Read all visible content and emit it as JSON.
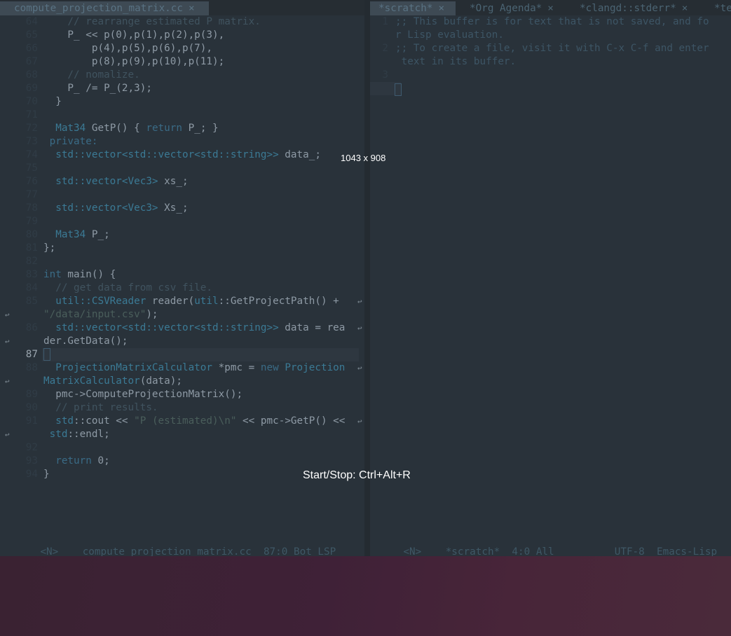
{
  "left_pane": {
    "tab_title": "compute_projection_matrix.cc",
    "tab_close": "×",
    "lines": [
      {
        "num": "64",
        "segments": [
          [
            "c-comment",
            "    // rearrange estimated P matrix."
          ]
        ]
      },
      {
        "num": "65",
        "segments": [
          [
            "c-text",
            "    P_ << p(0),p(1),p(2),p(3),"
          ]
        ]
      },
      {
        "num": "66",
        "segments": [
          [
            "c-text",
            "        p(4),p(5),p(6),p(7),"
          ]
        ]
      },
      {
        "num": "67",
        "segments": [
          [
            "c-text",
            "        p(8),p(9),p(10),p(11);"
          ]
        ]
      },
      {
        "num": "68",
        "segments": [
          [
            "c-comment",
            "    // nomalize."
          ]
        ]
      },
      {
        "num": "69",
        "segments": [
          [
            "c-text",
            "    P_ /= P_(2,3);"
          ]
        ]
      },
      {
        "num": "70",
        "segments": [
          [
            "c-text",
            "  }"
          ]
        ]
      },
      {
        "num": "71",
        "segments": []
      },
      {
        "num": "72",
        "segments": [
          [
            "c-type",
            "  Mat34"
          ],
          [
            "c-text",
            " GetP() { "
          ],
          [
            "c-kw",
            "return"
          ],
          [
            "c-text",
            " P_; }"
          ]
        ]
      },
      {
        "num": "73",
        "segments": [
          [
            "c-kw",
            " private:"
          ]
        ]
      },
      {
        "num": "74",
        "segments": [
          [
            "c-type",
            "  std::vector<std::vector<std::string>>"
          ],
          [
            "c-text",
            " data_;"
          ]
        ]
      },
      {
        "num": "75",
        "segments": []
      },
      {
        "num": "76",
        "segments": [
          [
            "c-type",
            "  std::vector<Vec3>"
          ],
          [
            "c-text",
            " xs_;"
          ]
        ]
      },
      {
        "num": "77",
        "segments": []
      },
      {
        "num": "78",
        "segments": [
          [
            "c-type",
            "  std::vector<Vec3>"
          ],
          [
            "c-text",
            " Xs_;"
          ]
        ]
      },
      {
        "num": "79",
        "segments": []
      },
      {
        "num": "80",
        "segments": [
          [
            "c-type",
            "  Mat34"
          ],
          [
            "c-text",
            " P_;"
          ]
        ]
      },
      {
        "num": "81",
        "segments": [
          [
            "c-text",
            "};"
          ]
        ]
      },
      {
        "num": "82",
        "segments": []
      },
      {
        "num": "83",
        "segments": [
          [
            "c-kw",
            "int"
          ],
          [
            "c-text",
            " main() {"
          ]
        ]
      },
      {
        "num": "84",
        "segments": [
          [
            "c-comment",
            "  // get data from csv file."
          ]
        ]
      },
      {
        "num": "85",
        "segments": [
          [
            "c-type",
            "  util::CSVReader"
          ],
          [
            "c-text",
            " reader("
          ],
          [
            "c-type",
            "util"
          ],
          [
            "c-text",
            "::GetProjectPath() + "
          ]
        ],
        "wrap": true
      },
      {
        "num": "",
        "segments": [
          [
            "c-str",
            "\"/data/input.csv\""
          ],
          [
            "c-text",
            ");"
          ]
        ],
        "mark": true
      },
      {
        "num": "86",
        "segments": [
          [
            "c-type",
            "  std::vector<std::vector<std::string>>"
          ],
          [
            "c-text",
            " data = rea"
          ]
        ],
        "wrap": true
      },
      {
        "num": "",
        "segments": [
          [
            "c-text",
            "der.GetData();"
          ]
        ],
        "mark": true
      },
      {
        "num": "87",
        "segments": [],
        "current": true
      },
      {
        "num": "88",
        "segments": [
          [
            "c-type",
            "  ProjectionMatrixCalculator"
          ],
          [
            "c-text",
            " *pmc = "
          ],
          [
            "c-kw",
            "new"
          ],
          [
            "c-type",
            " Projection"
          ]
        ],
        "wrap": true
      },
      {
        "num": "",
        "segments": [
          [
            "c-type",
            "MatrixCalculator"
          ],
          [
            "c-text",
            "(data);"
          ]
        ],
        "mark": true
      },
      {
        "num": "89",
        "segments": [
          [
            "c-text",
            "  pmc->ComputeProjectionMatrix();"
          ]
        ]
      },
      {
        "num": "90",
        "segments": [
          [
            "c-comment",
            "  // print results."
          ]
        ]
      },
      {
        "num": "91",
        "segments": [
          [
            "c-type",
            "  std"
          ],
          [
            "c-text",
            "::cout << "
          ],
          [
            "c-str",
            "\"P (estimated)\\n\""
          ],
          [
            "c-text",
            " << pmc->GetP() <<"
          ]
        ],
        "wrap": true
      },
      {
        "num": "",
        "segments": [
          [
            "c-type",
            " std"
          ],
          [
            "c-text",
            "::endl;"
          ]
        ],
        "mark": true
      },
      {
        "num": "92",
        "segments": []
      },
      {
        "num": "93",
        "segments": [
          [
            "c-kw",
            "  return"
          ],
          [
            "c-text",
            " 0;"
          ]
        ]
      },
      {
        "num": "94",
        "segments": [
          [
            "c-text",
            "}"
          ]
        ]
      }
    ],
    "modeline": {
      "state": "<N>",
      "filename": "compute_projection_matrix.cc",
      "position": "87:0",
      "scroll": "Bot",
      "lsp": "LSP"
    }
  },
  "right_pane": {
    "tabs": [
      {
        "title": "*scratch*",
        "close": "×",
        "active": true
      },
      {
        "title": "*Org Agenda*",
        "close": "×",
        "active": false
      },
      {
        "title": "*clangd::stderr*",
        "close": "×",
        "active": false
      },
      {
        "title": "*te",
        "close": "",
        "active": false
      }
    ],
    "lines": [
      {
        "num": "1",
        "text": ";; This buffer is for text that is not saved, and fo"
      },
      {
        "num": "",
        "text": "r Lisp evaluation.",
        "mark": true
      },
      {
        "num": "2",
        "text": ";; To create a file, visit it with C-x C-f and enter"
      },
      {
        "num": "",
        "text": " text in its buffer.",
        "mark": true
      },
      {
        "num": "3",
        "text": ""
      }
    ],
    "modeline": {
      "state": "<N>",
      "buffer": "*scratch*",
      "position": "4:0",
      "scroll": "All",
      "encoding": "UTF-8",
      "mode": "Emacs-Lisp"
    }
  },
  "overlay": {
    "size_label": "1043 x 908",
    "hint": "Start/Stop: Ctrl+Alt+R"
  },
  "wrap_glyph": "↩",
  "colors": {
    "editor_bg": "#29323a",
    "desktop": "#3f2137"
  }
}
